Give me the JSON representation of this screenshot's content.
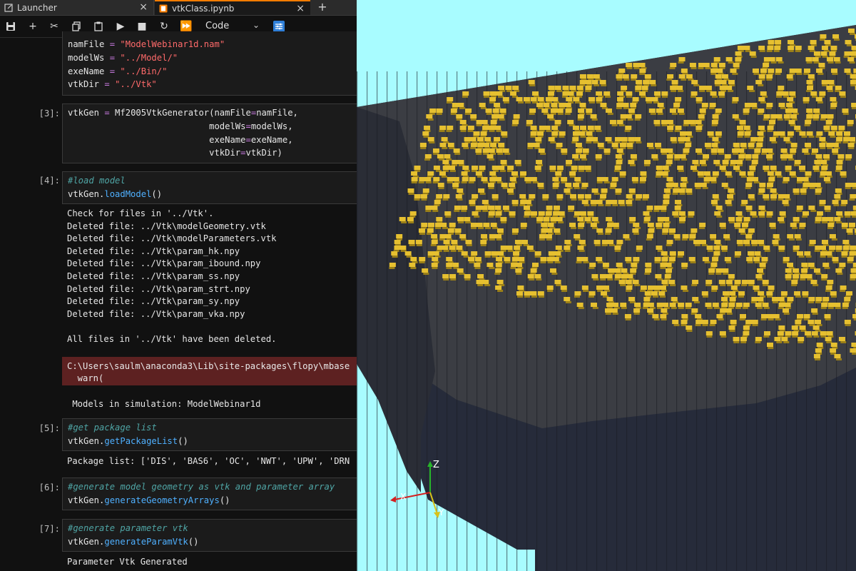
{
  "tabs": [
    {
      "label": "Launcher",
      "close": "×"
    },
    {
      "label": "vtkClass.ipynb",
      "close": "×"
    }
  ],
  "add_tab": "+",
  "toolbar": {
    "cell_type": "Code"
  },
  "cells": {
    "c2_lines": [
      {
        "var": "namFile",
        "op": "=",
        "val": "\"ModelWebinar1d.nam\""
      },
      {
        "var": "modelWs",
        "op": "=",
        "val": "\"../Model/\""
      },
      {
        "var": "exeName",
        "op": "=",
        "val": "\"../Bin/\""
      },
      {
        "var": "vtkDir",
        "op": "=",
        "val": "\"../Vtk\""
      }
    ],
    "c3_prompt": "[3]:",
    "c3_line1": "vtkGen = Mf2005VtkGenerator(namFile",
    "c3_line1b": "namFile,",
    "c3_line2a": "                           modelWs",
    "c3_line2b": "modelWs,",
    "c3_line3a": "                           exeName",
    "c3_line3b": "exeName,",
    "c3_line4a": "                           vtkDir",
    "c3_line4b": "vtkDir)",
    "c4_prompt": "[4]:",
    "c4_comment": "#load model",
    "c4_obj": "vtkGen.",
    "c4_func": "loadModel",
    "c4_paren": "()",
    "c4_output": [
      "Check for files in '../Vtk'.",
      "Deleted file: ../Vtk\\modelGeometry.vtk",
      "Deleted file: ../Vtk\\modelParameters.vtk",
      "Deleted file: ../Vtk\\param_hk.npy",
      "Deleted file: ../Vtk\\param_ibound.npy",
      "Deleted file: ../Vtk\\param_ss.npy",
      "Deleted file: ../Vtk\\param_strt.npy",
      "Deleted file: ../Vtk\\param_sy.npy",
      "Deleted file: ../Vtk\\param_vka.npy",
      "",
      "All files in '../Vtk' have been deleted."
    ],
    "c4_stderr_1": "C:\\Users\\saulm\\anaconda3\\Lib\\site-packages\\flopy\\mbase",
    "c4_stderr_2": "  warn(",
    "c4_models": " Models in simulation: ModelWebinar1d",
    "c5_prompt": "[5]:",
    "c5_comment": "#get package list",
    "c5_obj": "vtkGen.",
    "c5_func": "getPackageList",
    "c5_paren": "()",
    "c5_output": "Package list: ['DIS', 'BAS6', 'OC', 'NWT', 'UPW', 'DRN",
    "c6_prompt": "[6]:",
    "c6_comment": "#generate model geometry as vtk and parameter array",
    "c6_obj": "vtkGen.",
    "c6_func": "generateGeometryArrays",
    "c6_paren": "()",
    "c7_prompt": "[7]:",
    "c7_comment": "#generate parameter vtk",
    "c7_obj": "vtkGen.",
    "c7_func": "generateParamVtk",
    "c7_paren": "()",
    "c7_output": "Parameter Vtk Generated"
  },
  "viewer": {
    "background": "#a8fcff",
    "top_color": "#e6c030",
    "upper_layer_color": "#3b3d43",
    "lower_layer_color": "#262b3a",
    "axes": {
      "x": "X",
      "y": "Y",
      "z": "Z"
    }
  }
}
